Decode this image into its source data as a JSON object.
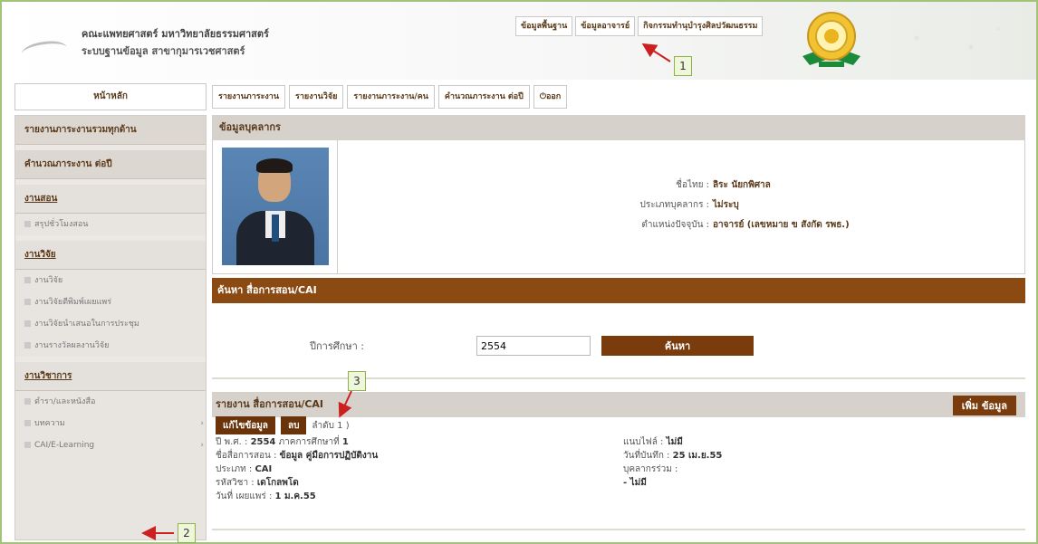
{
  "header": {
    "faculty_name": "คณะแพทยศาสตร์ มหาวิทยาลัยธรรมศาสตร์",
    "system_name": "ระบบฐานข้อมูล สาขากุมารเวชศาสตร์",
    "top_tabs": [
      "ข้อมูลพื้นฐาน",
      "ข้อมูลอาจารย์",
      "กิจกรรมทำนุบำรุงศิลปวัฒนธรรม"
    ]
  },
  "nav": {
    "home": "หน้าหลัก",
    "items": [
      "รายงานภาระงาน",
      "รายงานวิจัย",
      "รายงานภาระงาน/คน",
      "คำนวณภาระงาน ต่อปี",
      "ออก"
    ]
  },
  "sidebar": {
    "overall_report": "รายงานภาระงานรวมทุกด้าน",
    "calc_per_year": "คำนวณภาระงาน ต่อปี",
    "teaching": {
      "title": "งานสอน",
      "items": [
        "สรุปชั่วโมงสอน"
      ]
    },
    "research": {
      "title": "งานวิจัย",
      "items": [
        "งานวิจัย",
        "งานวิจัยตีพิมพ์เผยแพร่",
        "งานวิจัยนำเสนอในการประชุม",
        "งานรางวัลผลงานวิจัย"
      ]
    },
    "academic": {
      "title": "งานวิชาการ",
      "items": [
        "ตำรา/และหนังสือ",
        "บทความ",
        "CAI/E-Learning"
      ]
    }
  },
  "profile": {
    "section_title": "ข้อมูลบุคลากร",
    "name_label": "ชื่อไทย :",
    "name_value": "ลิระ นัยกพิศาล",
    "type_label": "ประเภทบุคลากร :",
    "type_value": "ไม่ระบุ",
    "position_label": "ตำแหน่งปัจจุบัน :",
    "position_value": "อาจารย์ (เลขหมาย ข สังกัด รพธ.)"
  },
  "search": {
    "section_title": "ค้นหา สื่อการสอน/CAI",
    "year_label": "ปีการศึกษา :",
    "year_value": "2554",
    "button": "ค้นหา"
  },
  "report": {
    "title": "รายงาน สื่อการสอน/CAI",
    "add_button": "เพิ่ม ข้อมูล",
    "edit_button": "แก้ไขข้อมูล",
    "delete_button": "ลบ",
    "order": "ลำดับ 1 )",
    "year_label": "ปี พ.ศ. :",
    "year_value": "2554",
    "semester_label": "ภาคการศึกษาที่",
    "semester_value": "1",
    "media_label": "ชื่อสื่อการสอน :",
    "media_value": "ข้อมูล คู่มือการปฏิบัติงาน",
    "type_label": "ประเภท :",
    "type_value": "CAI",
    "course_label": "รหัสวิชา :",
    "course_value": "เดโกลพโด",
    "publish_label": "วันที่ เผยแพร่ :",
    "publish_value": "1 ม.ค.55",
    "attach_label": "แนบไฟล์ :",
    "attach_value": "ไม่มี",
    "record_label": "วันที่บันทึก :",
    "record_value": "25 เม.ย.55",
    "co_label": "บุคลากรร่วม :",
    "co_value": "- ไม่มี"
  },
  "callouts": [
    "1",
    "2",
    "3"
  ],
  "colors": {
    "accent_brown": "#7a3c0c",
    "annotation_red": "#cc1f1f",
    "frame_green": "#a3c27a"
  }
}
